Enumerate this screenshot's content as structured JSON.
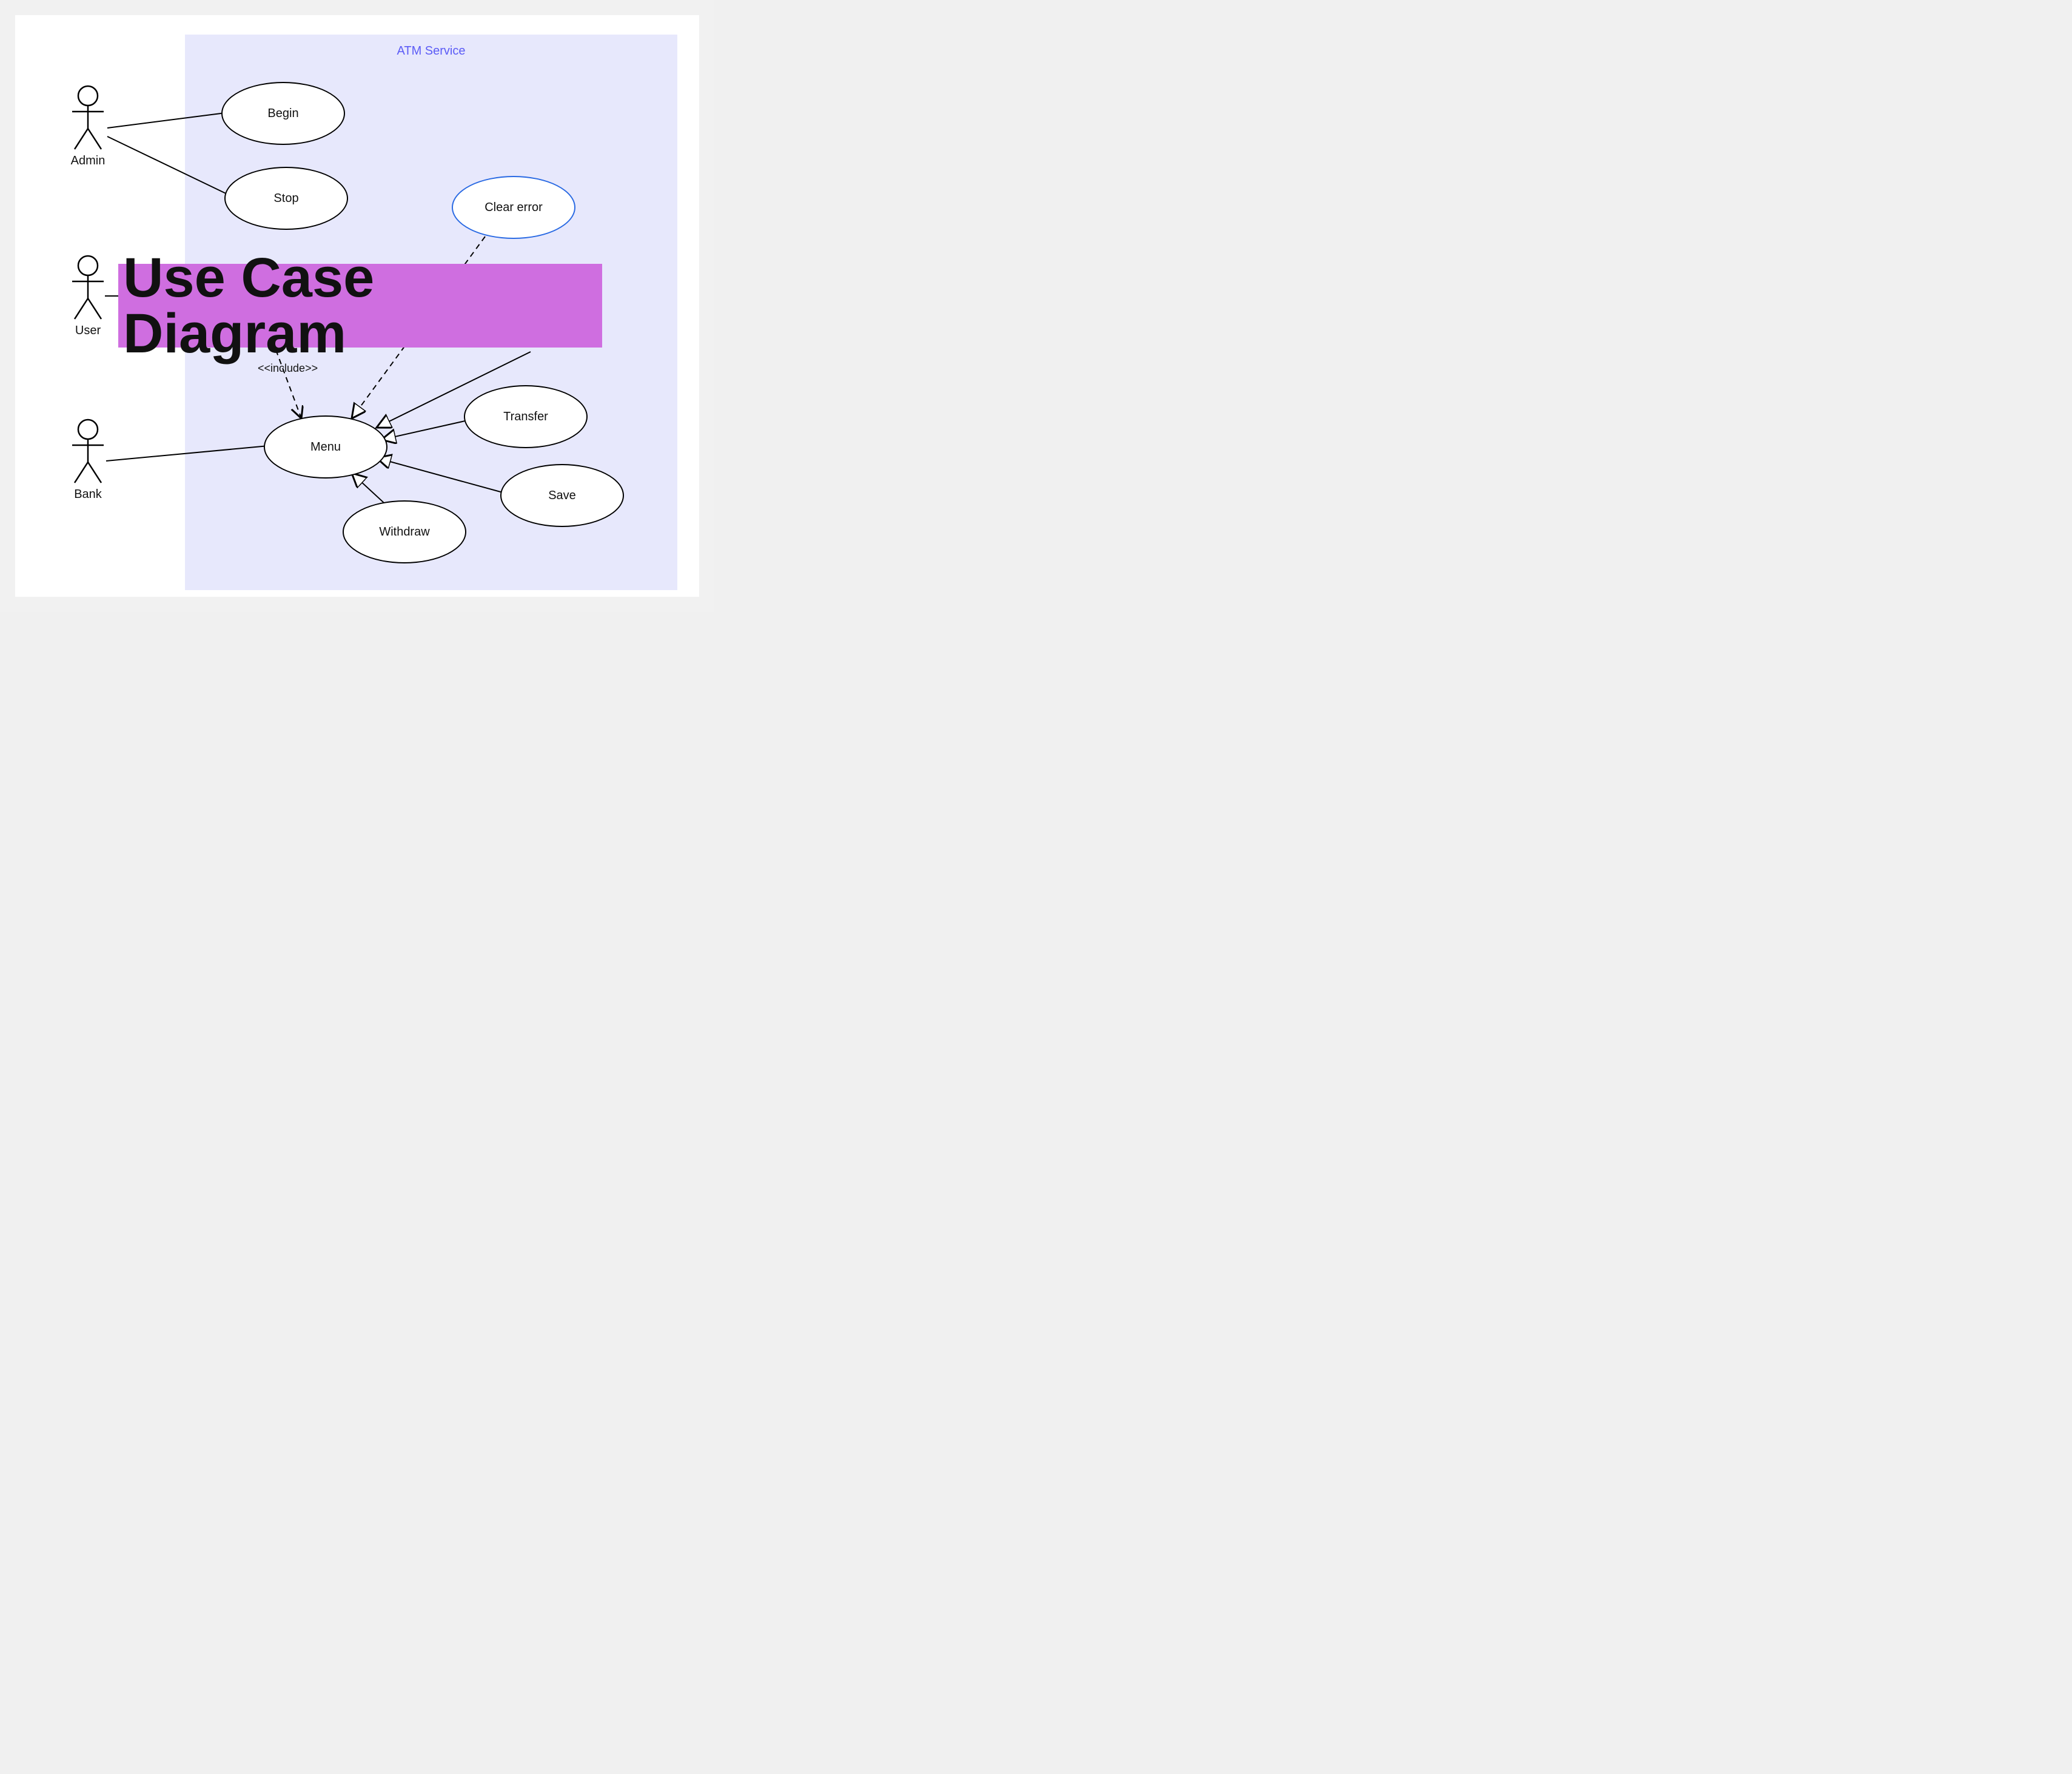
{
  "diagram_kind": "UML Use Case Diagram",
  "overlay": {
    "title": "Use Case Diagram"
  },
  "system": {
    "name": "ATM Service"
  },
  "actors": {
    "admin": {
      "label": "Admin"
    },
    "user": {
      "label": "User"
    },
    "bank": {
      "label": "Bank"
    }
  },
  "use_cases": {
    "begin": {
      "label": "Begin"
    },
    "stop": {
      "label": "Stop"
    },
    "clear_error": {
      "label": "Clear error"
    },
    "menu": {
      "label": "Menu"
    },
    "transfer": {
      "label": "Transfer"
    },
    "save": {
      "label": "Save"
    },
    "withdraw": {
      "label": "Withdraw"
    }
  },
  "relationships": {
    "include_label": "<<include>>"
  },
  "edges": [
    {
      "from": "actor:admin",
      "to": "usecase:begin",
      "type": "association"
    },
    {
      "from": "actor:admin",
      "to": "usecase:stop",
      "type": "association"
    },
    {
      "from": "actor:user",
      "to": "hidden-behind-banner",
      "type": "association"
    },
    {
      "from": "actor:bank",
      "to": "usecase:menu",
      "type": "association"
    },
    {
      "from": "hidden-behind-banner",
      "to": "usecase:menu",
      "type": "include",
      "label": "<<include>>"
    },
    {
      "from": "usecase:clear_error",
      "to": "usecase:menu",
      "type": "dependency"
    },
    {
      "from": "hidden-behind-banner-right",
      "to": "usecase:menu",
      "type": "generalization"
    },
    {
      "from": "usecase:transfer",
      "to": "usecase:menu",
      "type": "generalization"
    },
    {
      "from": "usecase:save",
      "to": "usecase:menu",
      "type": "generalization"
    },
    {
      "from": "usecase:withdraw",
      "to": "usecase:menu",
      "type": "generalization"
    }
  ],
  "colors": {
    "boundary_bg": "#e7e8fc",
    "boundary_title": "#5b5bf6",
    "selected_stroke": "#2a6ae3",
    "banner_bg": "#cf6ee0"
  }
}
